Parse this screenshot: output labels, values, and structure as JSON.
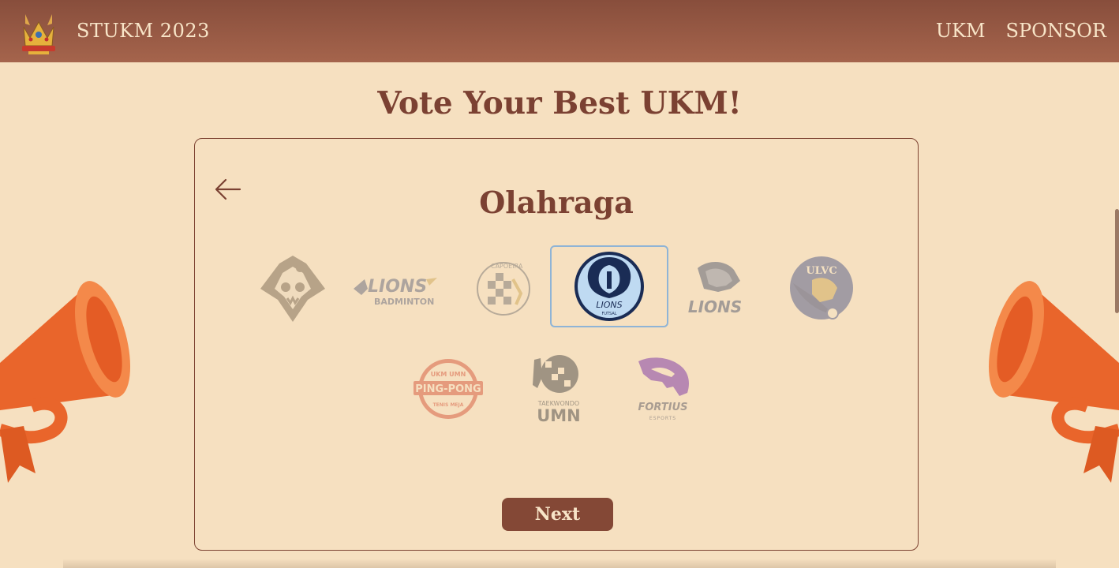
{
  "nav": {
    "title": "STUKM 2023",
    "links": [
      "UKM",
      "SPONSOR"
    ]
  },
  "heading": "Vote Your Best UKM!",
  "category": "Olahraga",
  "ukms": [
    {
      "name": "",
      "icon": "mask-shield-logo",
      "selected": false
    },
    {
      "name": "LIONS",
      "sub": "BADMINTON",
      "icon": "lions-badminton-logo",
      "selected": false
    },
    {
      "name": "CAPOEIRA",
      "icon": "capoeira-logo",
      "selected": false
    },
    {
      "name": "LIONS",
      "sub": "FUTSAL",
      "icon": "lions-futsal-logo",
      "selected": true
    },
    {
      "name": "LIONS",
      "icon": "lions-basketball-logo",
      "selected": false
    },
    {
      "name": "ULVC",
      "icon": "ulvc-logo",
      "selected": false
    },
    {
      "name": "PING-PONG",
      "top": "UKM   UMN",
      "sub": "TENIS MEJA",
      "icon": "ping-pong-logo",
      "selected": false
    },
    {
      "name": "UMN",
      "sub": "TAEKWONDO",
      "icon": "taekwondo-logo",
      "selected": false
    },
    {
      "name": "FORTIUS",
      "sub": "ESPORTS",
      "icon": "fortius-esports-logo",
      "selected": false
    }
  ],
  "next_label": "Next",
  "colors": {
    "background": "#f6e0c0",
    "navbar": "#94553f",
    "accent": "#7b4132",
    "selected_border": "#8fb4d6",
    "megaphone": "#f07a3c"
  }
}
